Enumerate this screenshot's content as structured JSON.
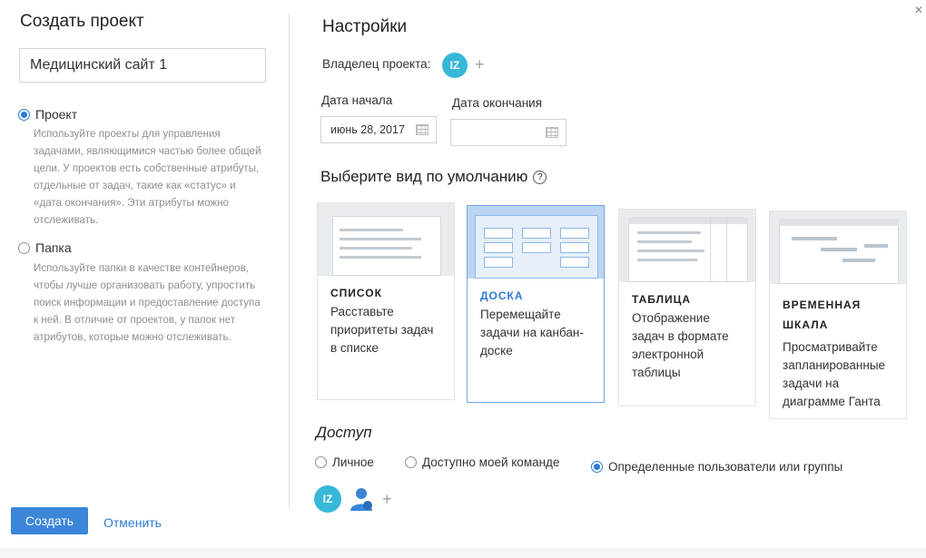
{
  "left": {
    "title": "Создать проект",
    "name_value": "Медицинский сайт 1",
    "type_options": [
      {
        "label": "Проект",
        "checked": true,
        "description": "Используйте проекты для управления задачами, являющимися частью более общей цели. У проектов есть собственные атрибуты, отдельные от задач, такие как «статус» и «дата окончания». Эти атрибуты можно отслеживать."
      },
      {
        "label": "Папка",
        "checked": false,
        "description": "Используйте папки в качестве контейнеров, чтобы лучше организовать работу, упростить поиск информации и предоставление доступа к ней. В отличие от проектов, у папок нет атрибутов, которые можно отслеживать."
      }
    ],
    "create_label": "Создать",
    "cancel_label": "Отменить"
  },
  "settings": {
    "title": "Настройки",
    "owner_label": "Владелец проекта:",
    "owner_initials": "IZ",
    "start_label": "Дата начала",
    "start_value": "июнь 28, 2017",
    "end_label": "Дата окончания",
    "end_value": ""
  },
  "views": {
    "title": "Выберите вид по умолчанию",
    "help_glyph": "?",
    "cards": [
      {
        "title": "СПИСОК",
        "desc": "Расставьте приоритеты задач в списке",
        "selected": false
      },
      {
        "title": "ДОСКА",
        "desc": "Перемещайте задачи на канбан-доске",
        "selected": true
      },
      {
        "title": "ТАБЛИЦА",
        "desc": "Отображение задач в формате электронной таблицы",
        "selected": false
      },
      {
        "title": "ВРЕМЕННАЯ ШКАЛА",
        "desc": "Просматривайте запланированные задачи на диаграмме Ганта",
        "selected": false
      }
    ]
  },
  "access": {
    "title": "Доступ",
    "options": [
      {
        "label": "Личное",
        "checked": false
      },
      {
        "label": "Доступно моей команде",
        "checked": false
      },
      {
        "label": "Определенные пользователи или группы",
        "checked": true
      }
    ],
    "member_initials": "IZ"
  },
  "colors": {
    "accent": "#2b7bd6",
    "button": "#3b86d8",
    "avatar": "#37b8d9"
  }
}
